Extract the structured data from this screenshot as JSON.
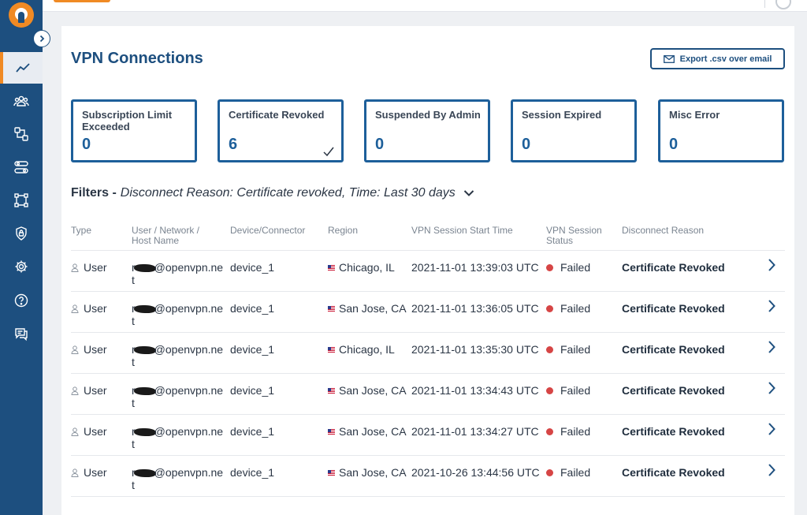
{
  "page": {
    "title": "VPN Connections",
    "export_label": "Export .csv over email"
  },
  "stats": [
    {
      "label": "Subscription Limit Exceeded",
      "value": "0",
      "selected": false
    },
    {
      "label": "Certificate Revoked",
      "value": "6",
      "selected": true
    },
    {
      "label": "Suspended By Admin",
      "value": "0",
      "selected": false
    },
    {
      "label": "Session Expired",
      "value": "0",
      "selected": false
    },
    {
      "label": "Misc Error",
      "value": "0",
      "selected": false
    }
  ],
  "filters": {
    "label": "Filters -",
    "value": "Disconnect Reason: Certificate revoked, Time: Last 30 days"
  },
  "table": {
    "columns": [
      "Type",
      "User / Network / Host Name",
      "Device/Connector",
      "Region",
      "VPN Session Start Time",
      "VPN Session Status",
      "Disconnect Reason"
    ],
    "rows": [
      {
        "type": "User",
        "user_prefix": "r",
        "user_suffix": "@openvpn.net",
        "device": "device_1",
        "region": "Chicago, IL",
        "start_time": "2021-11-01 13:39:03 UTC",
        "status": "Failed",
        "reason": "Certificate Revoked"
      },
      {
        "type": "User",
        "user_prefix": "r",
        "user_suffix": "@openvpn.net",
        "device": "device_1",
        "region": "San Jose, CA",
        "start_time": "2021-11-01 13:36:05 UTC",
        "status": "Failed",
        "reason": "Certificate Revoked"
      },
      {
        "type": "User",
        "user_prefix": "r",
        "user_suffix": "@openvpn.net",
        "device": "device_1",
        "region": "Chicago, IL",
        "start_time": "2021-11-01 13:35:30 UTC",
        "status": "Failed",
        "reason": "Certificate Revoked"
      },
      {
        "type": "User",
        "user_prefix": "r",
        "user_suffix": "@openvpn.net",
        "device": "device_1",
        "region": "San Jose, CA",
        "start_time": "2021-11-01 13:34:43 UTC",
        "status": "Failed",
        "reason": "Certificate Revoked"
      },
      {
        "type": "User",
        "user_prefix": "r",
        "user_suffix": "@openvpn.net",
        "device": "device_1",
        "region": "San Jose, CA",
        "start_time": "2021-11-01 13:34:27 UTC",
        "status": "Failed",
        "reason": "Certificate Revoked"
      },
      {
        "type": "User",
        "user_prefix": "r",
        "user_suffix": "@openvpn.net",
        "device": "device_1",
        "region": "San Jose, CA",
        "start_time": "2021-10-26 13:44:56 UTC",
        "status": "Failed",
        "reason": "Certificate Revoked"
      }
    ]
  },
  "sidebar": {
    "items": [
      {
        "icon": "chart-line-icon",
        "active": true
      },
      {
        "icon": "users-icon",
        "active": false
      },
      {
        "icon": "network-icon",
        "active": false
      },
      {
        "icon": "toggles-icon",
        "active": false
      },
      {
        "icon": "nodes-icon",
        "active": false
      },
      {
        "icon": "shield-icon",
        "active": false
      },
      {
        "icon": "gear-icon",
        "active": false
      },
      {
        "icon": "help-icon",
        "active": false
      },
      {
        "icon": "chat-icon",
        "active": false
      }
    ]
  },
  "colors": {
    "brand": "#1d4f7f",
    "accent": "#f08a24",
    "failed": "#d64545"
  }
}
